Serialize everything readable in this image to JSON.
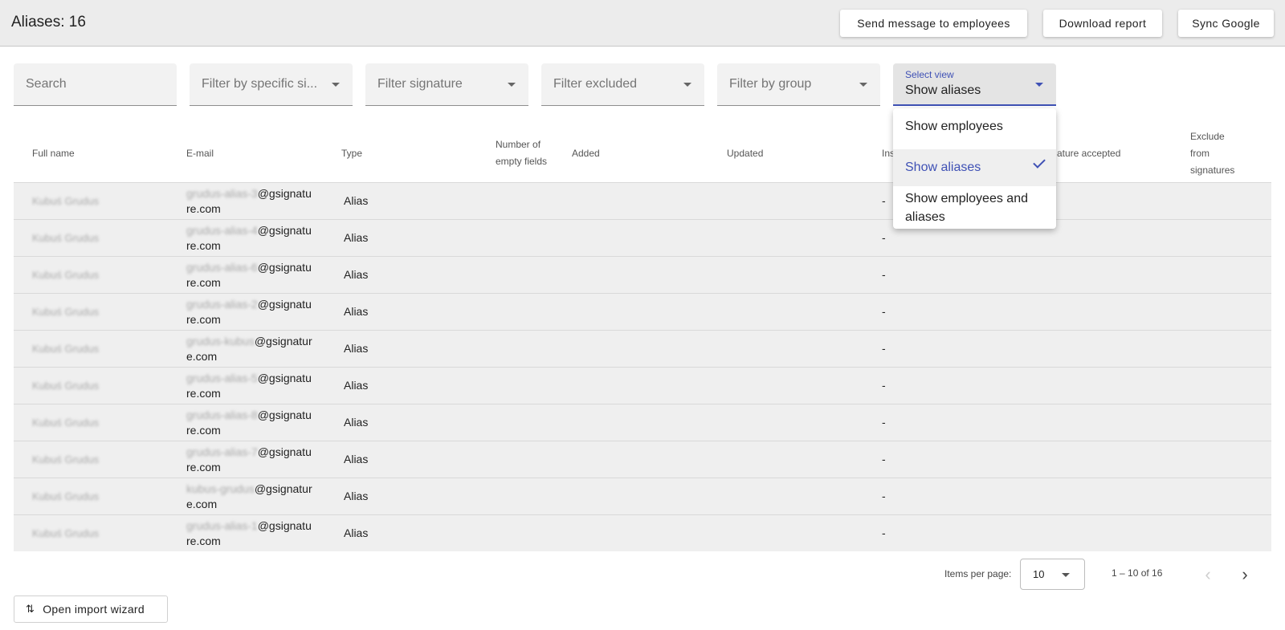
{
  "header": {
    "title": "Aliases: 16",
    "buttons": {
      "send": "Send message to employees",
      "download": "Download report",
      "sync": "Sync Google"
    }
  },
  "filters": {
    "search_placeholder": "Search",
    "specific_signature": "Filter by specific si...",
    "signature": "Filter signature",
    "excluded": "Filter excluded",
    "group": "Filter by group",
    "view_label": "Select view",
    "view_value": "Show aliases"
  },
  "view_menu": {
    "options": [
      "Show employees",
      "Show aliases",
      "Show employees and aliases"
    ],
    "selected": "Show aliases"
  },
  "table": {
    "columns": {
      "full_name": "Full name",
      "email": "E-mail",
      "type": "Type",
      "empty_fields": "Number of empty fields",
      "added": "Added",
      "updated": "Updated",
      "installed": "Ins",
      "signature_accepted": "ature accepted",
      "exclude": "Exclude from signatures"
    },
    "rows": [
      {
        "name": "Kubuś Grudus",
        "email_local": "grudus-alias-3",
        "email_domain": "@gsignature.com",
        "type": "Alias",
        "installed": "-"
      },
      {
        "name": "Kubuś Grudus",
        "email_local": "grudus-alias-4",
        "email_domain": "@gsignature.com",
        "type": "Alias",
        "installed": "-"
      },
      {
        "name": "Kubuś Grudus",
        "email_local": "grudus-alias-6",
        "email_domain": "@gsignature.com",
        "type": "Alias",
        "installed": "-"
      },
      {
        "name": "Kubuś Grudus",
        "email_local": "grudus-alias-2",
        "email_domain": "@gsignature.com",
        "type": "Alias",
        "installed": "-"
      },
      {
        "name": "Kubuś Grudus",
        "email_local": "grudus-kubus",
        "email_domain": "@gsignature.com",
        "type": "Alias",
        "installed": "-"
      },
      {
        "name": "Kubuś Grudus",
        "email_local": "grudus-alias-5",
        "email_domain": "@gsignature.com",
        "type": "Alias",
        "installed": "-"
      },
      {
        "name": "Kubuś Grudus",
        "email_local": "grudus-alias-8",
        "email_domain": "@gsignature.com",
        "type": "Alias",
        "installed": "-"
      },
      {
        "name": "Kubuś Grudus",
        "email_local": "grudus-alias-7",
        "email_domain": "@gsignature.com",
        "type": "Alias",
        "installed": "-"
      },
      {
        "name": "Kubuś Grudus",
        "email_local": "kubus-grudus",
        "email_domain": "@gsignature.com",
        "type": "Alias",
        "installed": "-"
      },
      {
        "name": "Kubuś Grudus",
        "email_local": "grudus-alias-1",
        "email_domain": "@gsignature.com",
        "type": "Alias",
        "installed": "-"
      }
    ]
  },
  "pagination": {
    "items_per_page_label": "Items per page:",
    "items_per_page": "10",
    "range": "1 – 10 of 16",
    "prev_icon": "chevron-left-icon",
    "next_icon": "chevron-right-icon"
  },
  "import_button": {
    "label": "Open import wizard",
    "icon": "import-arrows-icon"
  },
  "colors": {
    "accent": "#3f51b5",
    "topbar_bg": "#ececec",
    "row_bg": "#efefef"
  }
}
